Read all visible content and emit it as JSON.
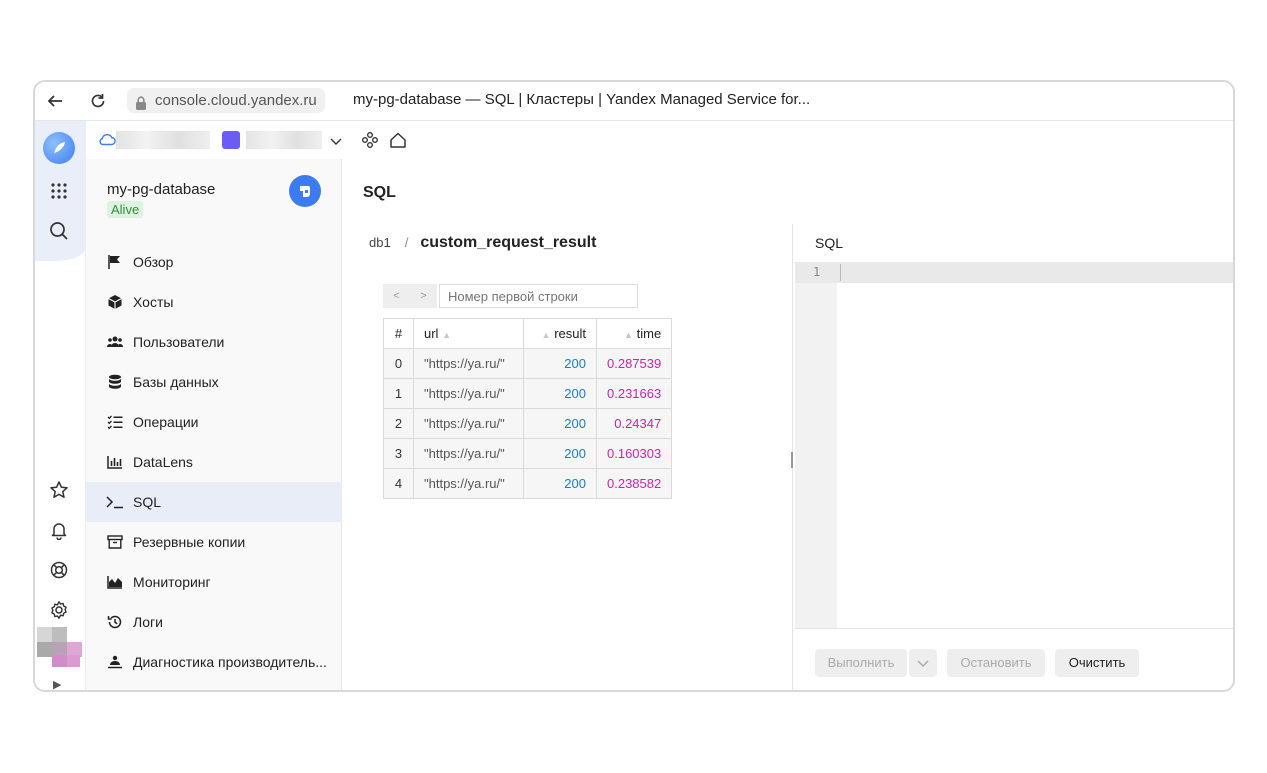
{
  "browser": {
    "url": "console.cloud.yandex.ru",
    "tab_title": "my-pg-database — SQL | Кластеры | Yandex Managed Service for..."
  },
  "sidebar": {
    "cluster_name": "my-pg-database",
    "status": "Alive",
    "items": [
      {
        "label": "Обзор",
        "icon": "flag-icon"
      },
      {
        "label": "Хосты",
        "icon": "cube-icon"
      },
      {
        "label": "Пользователи",
        "icon": "users-icon"
      },
      {
        "label": "Базы данных",
        "icon": "database-icon"
      },
      {
        "label": "Операции",
        "icon": "list-check-icon"
      },
      {
        "label": "DataLens",
        "icon": "bar-chart-icon"
      },
      {
        "label": "SQL",
        "icon": "terminal-icon"
      },
      {
        "label": "Резервные копии",
        "icon": "archive-icon"
      },
      {
        "label": "Мониторинг",
        "icon": "area-chart-icon"
      },
      {
        "label": "Логи",
        "icon": "history-icon"
      },
      {
        "label": "Диагностика производитель...",
        "icon": "diagnostics-icon"
      }
    ],
    "active_index": 6
  },
  "main": {
    "title": "SQL",
    "breadcrumb": {
      "db": "db1",
      "separator": "/",
      "table": "custom_request_result"
    },
    "pager": {
      "prev": "<",
      "next": ">",
      "placeholder": "Номер первой строки"
    },
    "table": {
      "headers": [
        "#",
        "url",
        "result",
        "time"
      ],
      "rows": [
        [
          "0",
          "\"https://ya.ru/\"",
          "200",
          "0.287539"
        ],
        [
          "1",
          "\"https://ya.ru/\"",
          "200",
          "0.231663"
        ],
        [
          "2",
          "\"https://ya.ru/\"",
          "200",
          "0.24347"
        ],
        [
          "3",
          "\"https://ya.ru/\"",
          "200",
          "0.160303"
        ],
        [
          "4",
          "\"https://ya.ru/\"",
          "200",
          "0.238582"
        ]
      ]
    }
  },
  "editor": {
    "label": "SQL",
    "line_number": "1",
    "run_label": "Выполнить",
    "stop_label": "Остановить",
    "clear_label": "Очистить"
  },
  "colors": {
    "accent": "#3d7cf0",
    "status_ok": "#2f8f3a",
    "number_blue": "#1a7bd6",
    "number_magenta": "#d01fb0",
    "active_nav": "#e8edf8"
  }
}
